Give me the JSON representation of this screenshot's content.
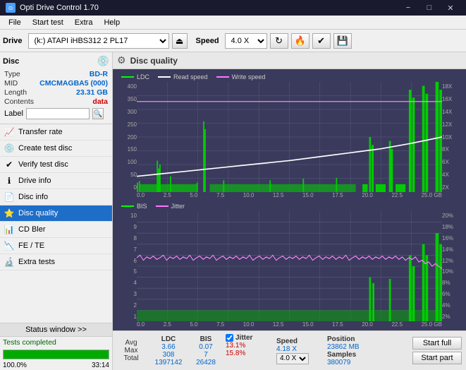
{
  "app": {
    "title": "Opti Drive Control 1.70",
    "icon": "⊙"
  },
  "titlebar": {
    "controls": [
      "−",
      "□",
      "✕"
    ]
  },
  "menubar": {
    "items": [
      "File",
      "Start test",
      "Extra",
      "Help"
    ]
  },
  "toolbar": {
    "drive_label": "Drive",
    "drive_value": "(k:) ATAPI iHBS312  2 PL17",
    "speed_label": "Speed",
    "speed_value": "4.0 X"
  },
  "disc": {
    "title": "Disc",
    "type_label": "Type",
    "type_value": "BD-R",
    "mid_label": "MID",
    "mid_value": "CMCMAGBA5 (000)",
    "length_label": "Length",
    "length_value": "23.31 GB",
    "contents_label": "Contents",
    "contents_value": "data",
    "label_label": "Label",
    "label_value": ""
  },
  "nav": {
    "items": [
      {
        "id": "transfer-rate",
        "label": "Transfer rate",
        "icon": "📈"
      },
      {
        "id": "create-test-disc",
        "label": "Create test disc",
        "icon": "💿"
      },
      {
        "id": "verify-test-disc",
        "label": "Verify test disc",
        "icon": "✔"
      },
      {
        "id": "drive-info",
        "label": "Drive info",
        "icon": "ℹ"
      },
      {
        "id": "disc-info",
        "label": "Disc info",
        "icon": "📄"
      },
      {
        "id": "disc-quality",
        "label": "Disc quality",
        "icon": "⭐",
        "active": true
      },
      {
        "id": "cd-bler",
        "label": "CD Bler",
        "icon": "📊"
      },
      {
        "id": "fe-te",
        "label": "FE / TE",
        "icon": "📉"
      },
      {
        "id": "extra-tests",
        "label": "Extra tests",
        "icon": "🔬"
      }
    ]
  },
  "status": {
    "window_btn": "Status window >>",
    "text": "Tests completed",
    "progress": 100,
    "time": "33:14"
  },
  "chart": {
    "title": "Disc quality",
    "gear_icon": "⚙",
    "upper": {
      "legend": [
        {
          "label": "LDC",
          "color": "#00ff00"
        },
        {
          "label": "Read speed",
          "color": "#ffffff"
        },
        {
          "label": "Write speed",
          "color": "#ff77ff"
        }
      ],
      "y_left": [
        "400",
        "350",
        "300",
        "250",
        "200",
        "150",
        "100",
        "50",
        "0"
      ],
      "y_right": [
        "18X",
        "16X",
        "14X",
        "12X",
        "10X",
        "8X",
        "6X",
        "4X",
        "2X"
      ],
      "x_labels": [
        "0.0",
        "2.5",
        "5.0",
        "7.5",
        "10.0",
        "12.5",
        "15.0",
        "17.5",
        "20.0",
        "22.5",
        "25.0 GB"
      ]
    },
    "lower": {
      "legend": [
        {
          "label": "BIS",
          "color": "#00ff00"
        },
        {
          "label": "Jitter",
          "color": "#ff77ff"
        }
      ],
      "y_left": [
        "10",
        "9",
        "8",
        "7",
        "6",
        "5",
        "4",
        "3",
        "2",
        "1"
      ],
      "y_right": [
        "20%",
        "18%",
        "16%",
        "14%",
        "12%",
        "10%",
        "8%",
        "6%",
        "4%",
        "2%"
      ],
      "x_labels": [
        "0.0",
        "2.5",
        "5.0",
        "7.5",
        "10.0",
        "12.5",
        "15.0",
        "17.5",
        "20.0",
        "22.5",
        "25.0 GB"
      ]
    },
    "stats": {
      "ldc_label": "LDC",
      "bis_label": "BIS",
      "jitter_label": "Jitter",
      "jitter_checked": true,
      "speed_label": "Speed",
      "speed_value": "4.18 X",
      "speed_select": "4.0 X",
      "avg_label": "Avg",
      "ldc_avg": "3.66",
      "bis_avg": "0.07",
      "jitter_avg": "13.1%",
      "max_label": "Max",
      "ldc_max": "308",
      "bis_max": "7",
      "jitter_max": "15.8%",
      "total_label": "Total",
      "ldc_total": "1397142",
      "bis_total": "26428",
      "position_label": "Position",
      "position_value": "23862 MB",
      "samples_label": "Samples",
      "samples_value": "380079",
      "start_full": "Start full",
      "start_part": "Start part"
    }
  }
}
